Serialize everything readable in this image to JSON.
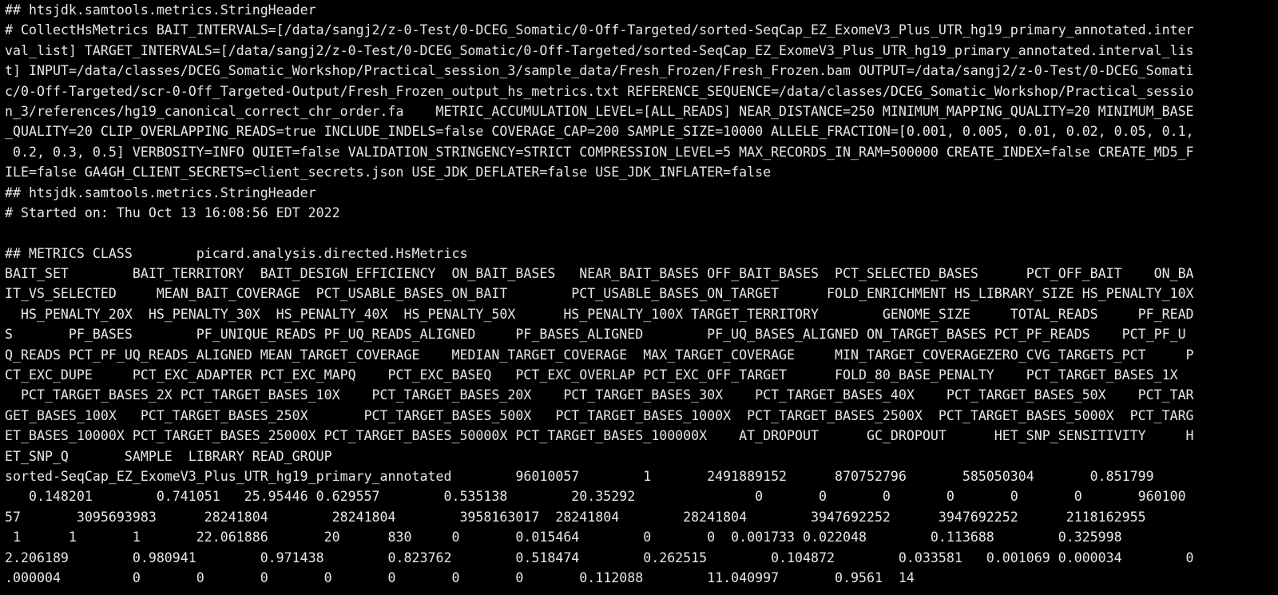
{
  "terminal": {
    "foreground": "#e6e6e6",
    "background": "#000000",
    "lines": [
      "## htsjdk.samtools.metrics.StringHeader",
      "# CollectHsMetrics BAIT_INTERVALS=[/data/sangj2/z-0-Test/0-DCEG_Somatic/0-Off-Targeted/sorted-SeqCap_EZ_ExomeV3_Plus_UTR_hg19_primary_annotated.inter",
      "val_list] TARGET_INTERVALS=[/data/sangj2/z-0-Test/0-DCEG_Somatic/0-Off-Targeted/sorted-SeqCap_EZ_ExomeV3_Plus_UTR_hg19_primary_annotated.interval_lis",
      "t] INPUT=/data/classes/DCEG_Somatic_Workshop/Practical_session_3/sample_data/Fresh_Frozen/Fresh_Frozen.bam OUTPUT=/data/sangj2/z-0-Test/0-DCEG_Somati",
      "c/0-Off-Targeted/scr-0-Off_Targeted-Output/Fresh_Frozen_output_hs_metrics.txt REFERENCE_SEQUENCE=/data/classes/DCEG_Somatic_Workshop/Practical_sessio",
      "n_3/references/hg19_canonical_correct_chr_order.fa    METRIC_ACCUMULATION_LEVEL=[ALL_READS] NEAR_DISTANCE=250 MINIMUM_MAPPING_QUALITY=20 MINIMUM_BASE",
      "_QUALITY=20 CLIP_OVERLAPPING_READS=true INCLUDE_INDELS=false COVERAGE_CAP=200 SAMPLE_SIZE=10000 ALLELE_FRACTION=[0.001, 0.005, 0.01, 0.02, 0.05, 0.1,",
      " 0.2, 0.3, 0.5] VERBOSITY=INFO QUIET=false VALIDATION_STRINGENCY=STRICT COMPRESSION_LEVEL=5 MAX_RECORDS_IN_RAM=500000 CREATE_INDEX=false CREATE_MD5_F",
      "ILE=false GA4GH_CLIENT_SECRETS=client_secrets.json USE_JDK_DEFLATER=false USE_JDK_INFLATER=false",
      "## htsjdk.samtools.metrics.StringHeader",
      "# Started on: Thu Oct 13 16:08:56 EDT 2022",
      "",
      "## METRICS CLASS        picard.analysis.directed.HsMetrics",
      "BAIT_SET        BAIT_TERRITORY  BAIT_DESIGN_EFFICIENCY  ON_BAIT_BASES   NEAR_BAIT_BASES OFF_BAIT_BASES  PCT_SELECTED_BASES      PCT_OFF_BAIT    ON_BA",
      "IT_VS_SELECTED     MEAN_BAIT_COVERAGE  PCT_USABLE_BASES_ON_BAIT        PCT_USABLE_BASES_ON_TARGET      FOLD_ENRICHMENT HS_LIBRARY_SIZE HS_PENALTY_10X",
      "  HS_PENALTY_20X  HS_PENALTY_30X  HS_PENALTY_40X  HS_PENALTY_50X      HS_PENALTY_100X TARGET_TERRITORY        GENOME_SIZE     TOTAL_READS     PF_READ",
      "S       PF_BASES        PF_UNIQUE_READS PF_UQ_READS_ALIGNED     PF_BASES_ALIGNED        PF_UQ_BASES_ALIGNED ON_TARGET_BASES PCT_PF_READS    PCT_PF_U",
      "Q_READS PCT_PF_UQ_READS_ALIGNED MEAN_TARGET_COVERAGE    MEDIAN_TARGET_COVERAGE  MAX_TARGET_COVERAGE     MIN_TARGET_COVERAGEZERO_CVG_TARGETS_PCT     P",
      "CT_EXC_DUPE     PCT_EXC_ADAPTER PCT_EXC_MAPQ    PCT_EXC_BASEQ   PCT_EXC_OVERLAP PCT_EXC_OFF_TARGET      FOLD_80_BASE_PENALTY    PCT_TARGET_BASES_1X",
      "  PCT_TARGET_BASES_2X PCT_TARGET_BASES_10X    PCT_TARGET_BASES_20X    PCT_TARGET_BASES_30X    PCT_TARGET_BASES_40X    PCT_TARGET_BASES_50X    PCT_TAR",
      "GET_BASES_100X   PCT_TARGET_BASES_250X       PCT_TARGET_BASES_500X   PCT_TARGET_BASES_1000X  PCT_TARGET_BASES_2500X  PCT_TARGET_BASES_5000X  PCT_TARG",
      "ET_BASES_10000X PCT_TARGET_BASES_25000X PCT_TARGET_BASES_50000X PCT_TARGET_BASES_100000X    AT_DROPOUT      GC_DROPOUT      HET_SNP_SENSITIVITY     H",
      "ET_SNP_Q       SAMPLE  LIBRARY READ_GROUP",
      "sorted-SeqCap_EZ_ExomeV3_Plus_UTR_hg19_primary_annotated        96010057        1       2491889152      870752796       585050304       0.851799",
      "   0.148201        0.741051   25.95446 0.629557        0.535138        20.35292               0       0       0       0       0       0       960100",
      "57       3095693983      28241804        28241804        3958163017  28241804        28241804        3947692252      3947692252      2118162955",
      " 1      1       1       22.061886       20      830     0       0.015464        0       0  0.001733 0.022048        0.113688        0.325998",
      "2.206189        0.980941        0.971438        0.823762        0.518474        0.262515        0.104872        0.033581   0.001069 0.000034        0",
      ".000004         0       0       0       0       0       0       0       0.112088        11.040997       0.9561  14"
    ]
  }
}
